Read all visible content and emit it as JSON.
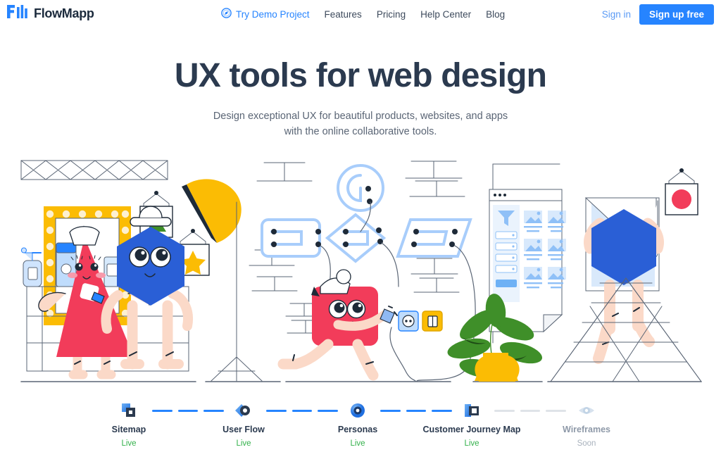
{
  "brand": {
    "name": "FlowMapp",
    "logo_icon": "flowmapp-bars-logo",
    "accent": "#2684ff"
  },
  "nav": {
    "items": [
      {
        "label": "Try Demo Project",
        "icon": "compass-icon",
        "highlight": true
      },
      {
        "label": "Features",
        "icon": null,
        "highlight": false
      },
      {
        "label": "Pricing",
        "icon": null,
        "highlight": false
      },
      {
        "label": "Help Center",
        "icon": null,
        "highlight": false
      },
      {
        "label": "Blog",
        "icon": null,
        "highlight": false
      }
    ]
  },
  "auth": {
    "signin_label": "Sign in",
    "signup_label": "Sign up free",
    "signup_bg": "#2684ff"
  },
  "hero": {
    "title": "UX tools for web design",
    "subtitle_line1": "Design exceptional UX for beautiful products, websites, and apps",
    "subtitle_line2": "with the online collaborative tools."
  },
  "illustration": {
    "alt": "Illustration of shape characters using UX design tools in a studio",
    "colors": {
      "pink": "#f23c5a",
      "blue": "#2a5fd6",
      "yellow": "#fbbc04",
      "skin": "#fbd9c8",
      "green": "#3f8f29",
      "line": "#5a6575",
      "light_blue": "#a8cdfb"
    }
  },
  "features": {
    "items": [
      {
        "label": "Sitemap",
        "status": "Live",
        "icon": "sitemap-icon",
        "active": true
      },
      {
        "label": "User Flow",
        "status": "Live",
        "icon": "userflow-icon",
        "active": true
      },
      {
        "label": "Personas",
        "status": "Live",
        "icon": "personas-icon",
        "active": true
      },
      {
        "label": "Customer Journey Map",
        "status": "Live",
        "icon": "cjm-icon",
        "active": true
      },
      {
        "label": "Wireframes",
        "status": "Soon",
        "icon": "wireframes-eye-icon",
        "active": false
      }
    ],
    "live_color": "#33b14b",
    "soon_color": "#a9b2bd"
  }
}
